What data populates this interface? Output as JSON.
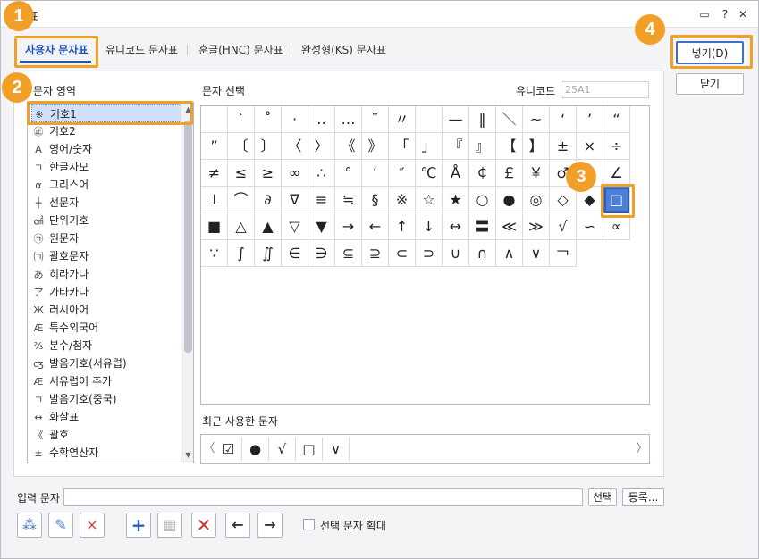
{
  "window": {
    "title_partial": "표"
  },
  "titlebar_buttons": {
    "feedback": "▭",
    "help": "?",
    "close": "✕"
  },
  "tabs": [
    {
      "label": "사용자 문자표",
      "active": true
    },
    {
      "label": "유니코드 문자표",
      "active": false
    },
    {
      "label": "훈글(HNC) 문자표",
      "active": false
    },
    {
      "label": "완성형(KS) 문자표",
      "active": false
    }
  ],
  "area": {
    "label": "문자 영역",
    "items": [
      {
        "icon": "※",
        "label": "기호1",
        "selected": true
      },
      {
        "icon": "㊣",
        "label": "기호2"
      },
      {
        "icon": "A",
        "label": "영어/숫자"
      },
      {
        "icon": "ㄱ",
        "label": "한글자모"
      },
      {
        "icon": "α",
        "label": "그리스어"
      },
      {
        "icon": "┼",
        "label": "선문자"
      },
      {
        "icon": "㎠",
        "label": "단위기호"
      },
      {
        "icon": "㉠",
        "label": "원문자"
      },
      {
        "icon": "㈀",
        "label": "괄호문자"
      },
      {
        "icon": "あ",
        "label": "히라가나"
      },
      {
        "icon": "ア",
        "label": "가타카나"
      },
      {
        "icon": "Ж",
        "label": "러시아어"
      },
      {
        "icon": "Æ",
        "label": "특수외국어"
      },
      {
        "icon": "⅔",
        "label": "분수/첨자"
      },
      {
        "icon": "ʤ",
        "label": "발음기호(서유럽)"
      },
      {
        "icon": "Æ",
        "label": "서유럽어 추가"
      },
      {
        "icon": "ㄱ",
        "label": "발음기호(중국)"
      },
      {
        "icon": "↔",
        "label": "화살표"
      },
      {
        "icon": "《",
        "label": "괄호"
      },
      {
        "icon": "±",
        "label": "수학연산자"
      }
    ]
  },
  "char_select": {
    "label": "문자 선택",
    "unicode_label": "유니코드",
    "unicode_value": "25A1"
  },
  "chars": [
    "",
    "ˋ",
    "˚",
    "·",
    "‥",
    "…",
    "¨",
    "〃",
    "",
    "—",
    "‖",
    "＼",
    "∼",
    "‘",
    "’",
    "“",
    "”",
    "〔",
    "〕",
    "〈",
    "〉",
    "《",
    "》",
    "「",
    "」",
    "『",
    "』",
    "【",
    "】",
    "±",
    "×",
    "÷",
    "≠",
    "≤",
    "≥",
    "∞",
    "∴",
    "°",
    "′",
    "″",
    "℃",
    "Å",
    "￠",
    "￡",
    "￥",
    "♂",
    "♀",
    "∠",
    "⊥",
    "⌒",
    "∂",
    "∇",
    "≡",
    "≒",
    "§",
    "※",
    "☆",
    "★",
    "○",
    "●",
    "◎",
    "◇",
    "◆",
    "□",
    "■",
    "△",
    "▲",
    "▽",
    "▼",
    "→",
    "←",
    "↑",
    "↓",
    "↔",
    "〓",
    "≪",
    "≫",
    "√",
    "∽",
    "∝",
    "∵",
    "∫",
    "∬",
    "∈",
    "∋",
    "⊆",
    "⊇",
    "⊂",
    "⊃",
    "∪",
    "∩",
    "∧",
    "∨",
    "￢"
  ],
  "selected_char_index": 63,
  "recent": {
    "label": "최근 사용한 문자",
    "chars": [
      "☑",
      "●",
      "√",
      "□",
      "∨"
    ]
  },
  "input": {
    "label": "입력 문자",
    "value": "",
    "select_btn": "선택",
    "register_btn": "등록..."
  },
  "buttons": {
    "insert": "넣기(D)",
    "close": "닫기"
  },
  "checkbox": {
    "label": "선택 문자 확대",
    "checked": false
  },
  "badges": [
    "1",
    "2",
    "3",
    "4"
  ],
  "colors": {
    "accent": "#f0a028",
    "selection": "#4c7fd8",
    "active_tab": "#2456b8"
  }
}
